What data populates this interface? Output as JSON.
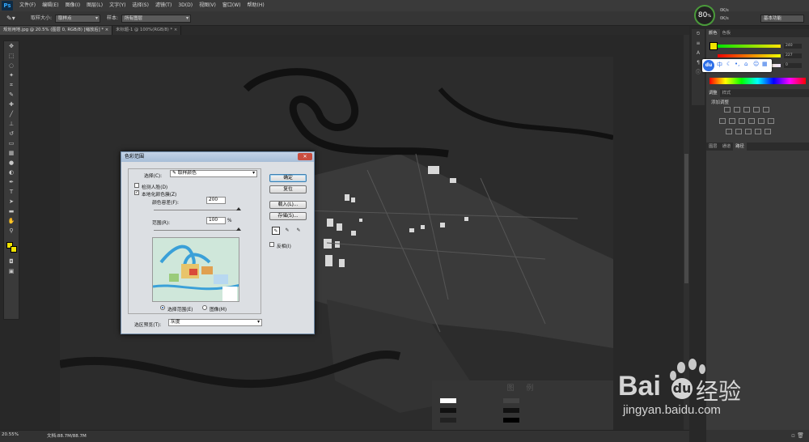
{
  "app": {
    "logo": "Ps"
  },
  "menu": [
    "文件(F)",
    "编辑(E)",
    "图像(I)",
    "图层(L)",
    "文字(Y)",
    "选择(S)",
    "滤镜(T)",
    "3D(D)",
    "视图(V)",
    "窗口(W)",
    "帮助(H)"
  ],
  "options": {
    "sample_size_label": "取样大小:",
    "sample_size_value": "取样点",
    "sample_label": "样本:",
    "sample_value": "所有图层",
    "workspace": "基本功能"
  },
  "gauge": {
    "percent": "80",
    "pct_sign": "%",
    "up": "0K/s",
    "down": "0K/s"
  },
  "tabs": [
    {
      "label": "规划用地.jpg @ 20.5% (图层 0, RGB/8) [缩放后] *"
    },
    {
      "label": "未标题-1 @ 100%(RGB/8) *"
    }
  ],
  "status": {
    "zoom": "20.55%",
    "doc": "文档:88.7M/88.7M"
  },
  "panels": {
    "color_tabs": [
      "颜色",
      "色板"
    ],
    "color_values": [
      "240",
      "227",
      "0"
    ],
    "adjust_tabs": [
      "调整",
      "样式"
    ],
    "adjust_label": "添加调整",
    "layers_tabs": [
      "图层",
      "通道",
      "路径"
    ]
  },
  "baidu_bar": {
    "logo": "du",
    "lang": "中"
  },
  "canvas": {
    "legend_title": "图 例"
  },
  "dialog": {
    "title": "色彩范围",
    "select_label": "选择(C):",
    "select_value": "取样颜色",
    "detect_faces": "检测人脸(D)",
    "localized": "本地化颜色簇(Z)",
    "fuzziness_label": "颜色容差(F):",
    "fuzziness_value": "200",
    "range_label": "范围(R):",
    "range_value": "100",
    "range_unit": "%",
    "radio_selection": "选择范围(E)",
    "radio_image": "图像(M)",
    "preview_label": "选区预览(T):",
    "preview_value": "灰度",
    "ok": "确定",
    "reset": "复位",
    "load": "载入(L)...",
    "save": "存储(S)...",
    "invert": "反相(I)"
  },
  "watermark": {
    "brand": "Bai",
    "brand2": "经验",
    "url": "jingyan.baidu.com"
  }
}
